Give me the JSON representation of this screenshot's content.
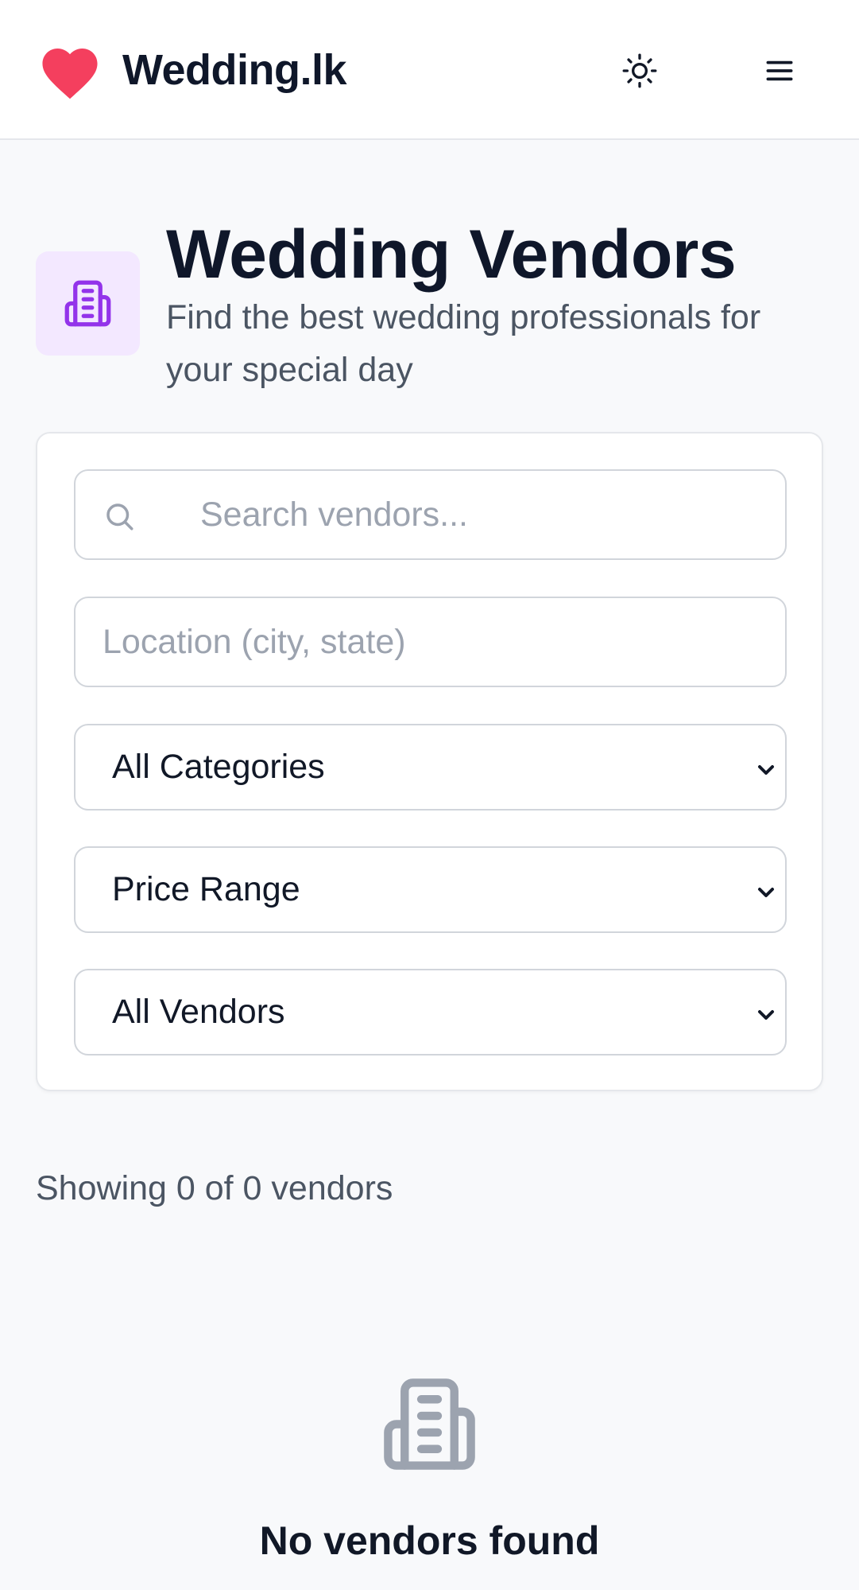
{
  "header": {
    "brand": "Wedding.lk",
    "theme_toggle_icon": "sun-icon",
    "menu_icon": "hamburger-menu-icon",
    "logo_icon": "heart-icon",
    "logo_color": "#f43f5e"
  },
  "hero": {
    "icon": "building-icon",
    "icon_color": "#9333ea",
    "icon_bg": "#f3e8ff",
    "title": "Wedding Vendors",
    "subtitle": "Find the best wedding professionals for your special day"
  },
  "filters": {
    "search": {
      "placeholder": "Search vendors...",
      "value": ""
    },
    "location": {
      "placeholder": "Location (city, state)",
      "value": ""
    },
    "category": {
      "selected": "All Categories"
    },
    "price": {
      "selected": "Price Range"
    },
    "vendor_type": {
      "selected": "All Vendors"
    }
  },
  "results": {
    "summary": "Showing 0 of 0 vendors",
    "shown": 0,
    "total": 0
  },
  "empty_state": {
    "icon": "building-icon",
    "title": "No vendors found"
  }
}
